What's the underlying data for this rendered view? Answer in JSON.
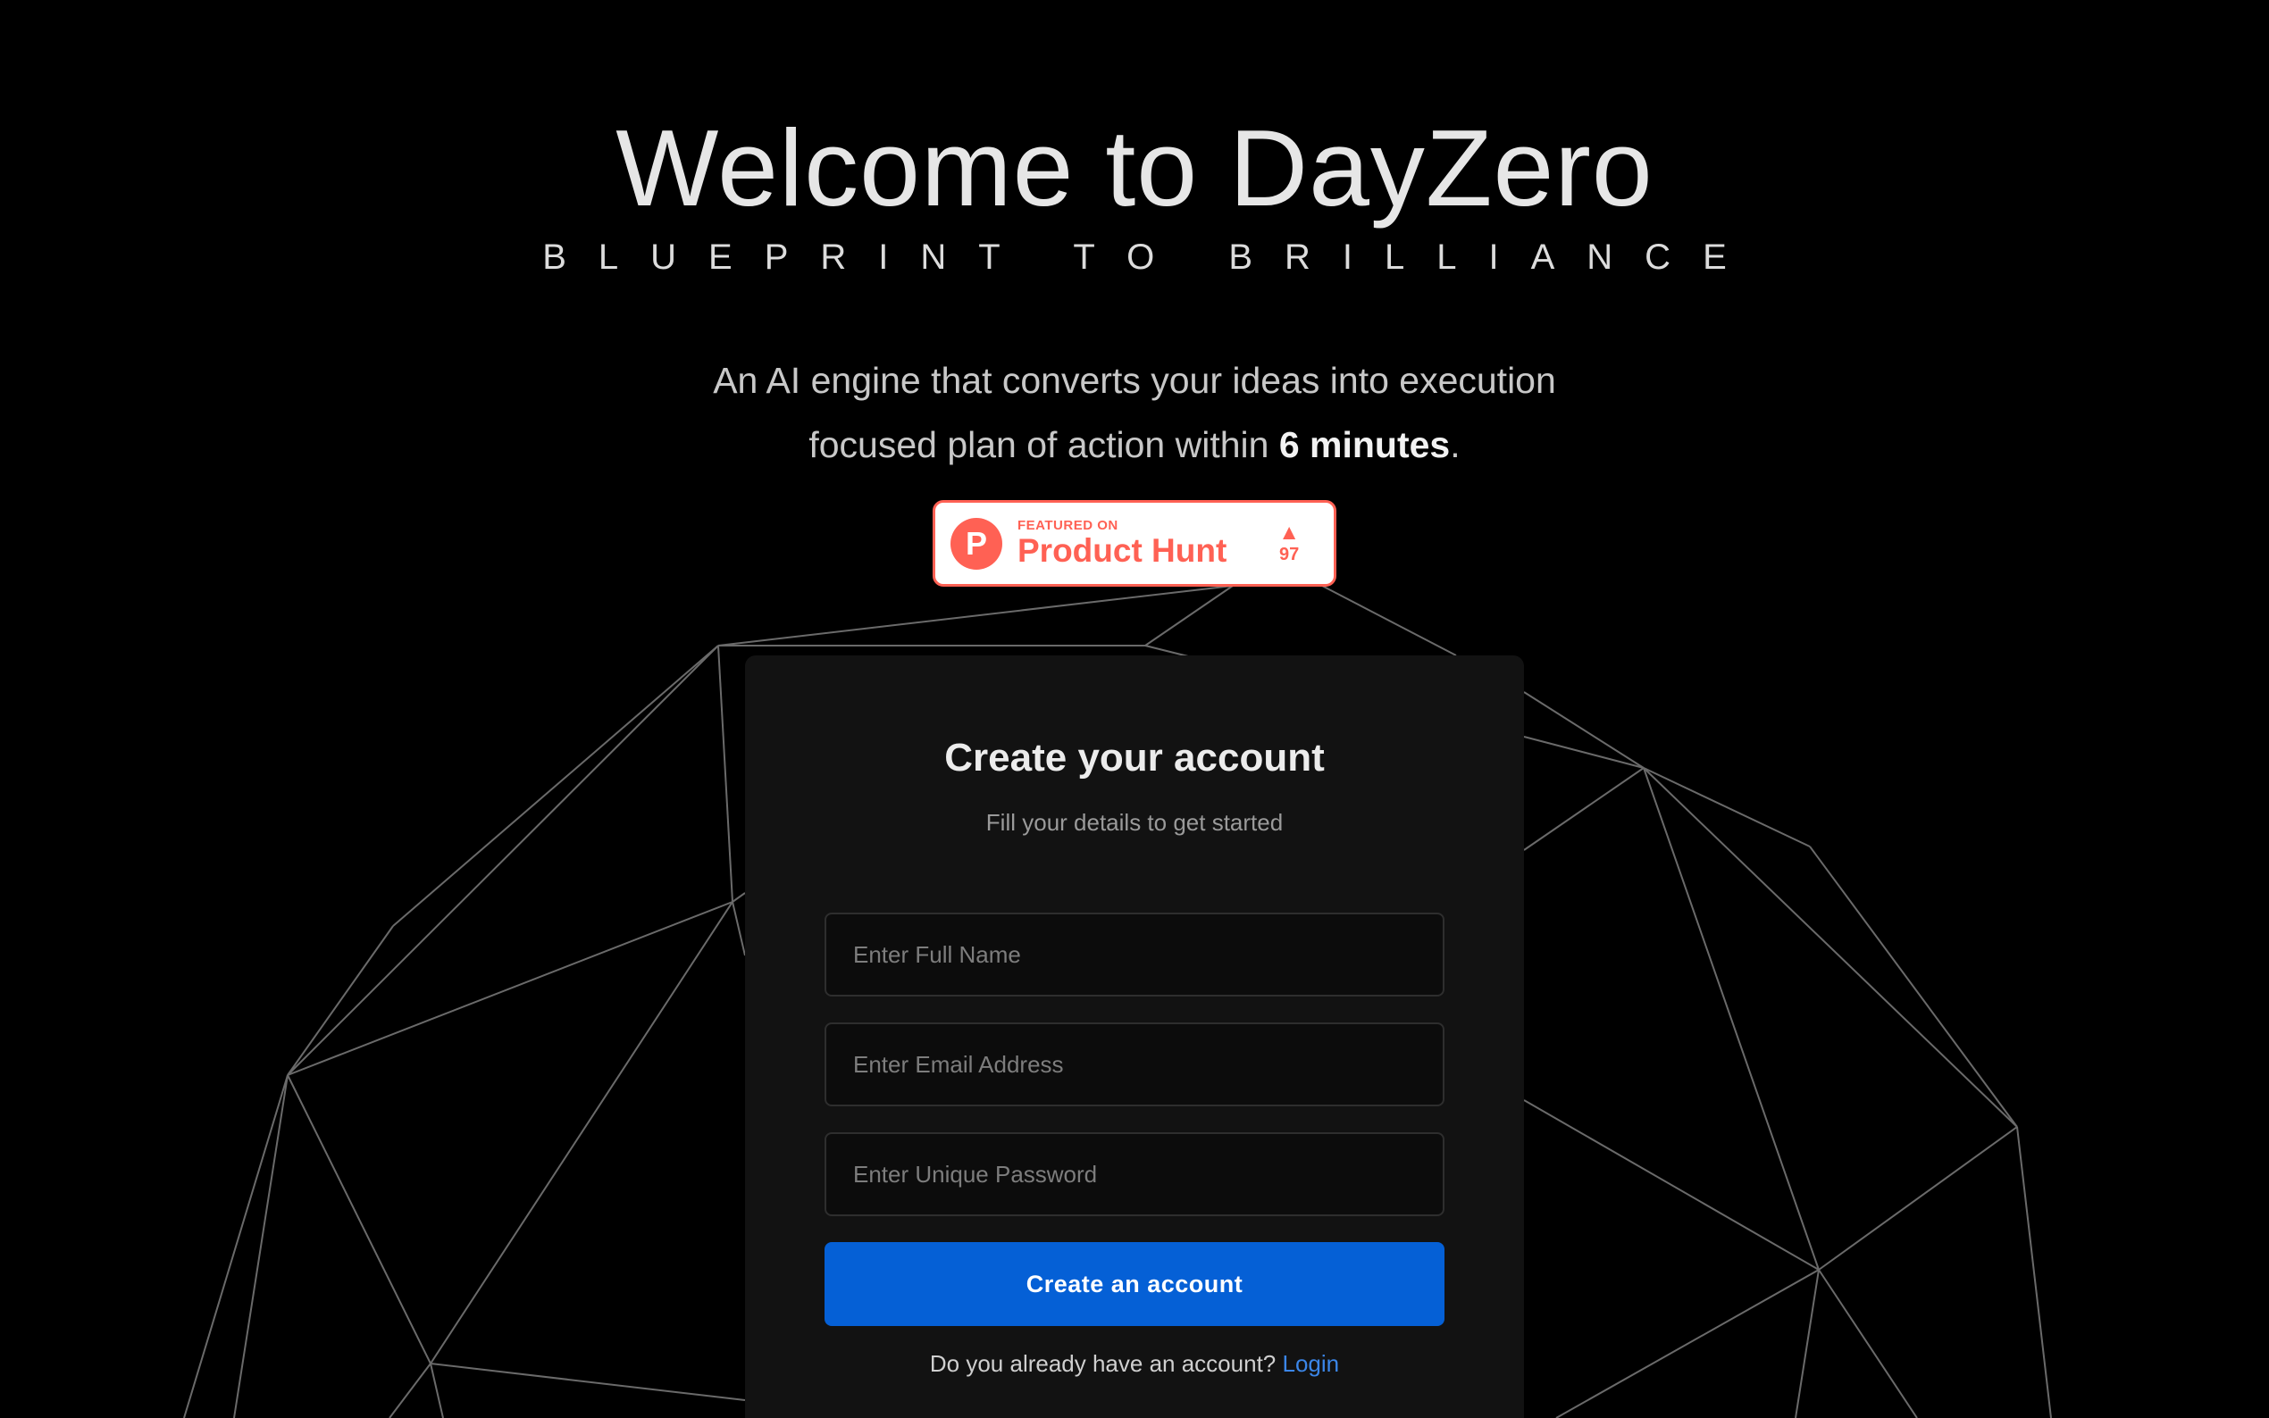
{
  "hero": {
    "title": "Welcome to DayZero",
    "tagline": "BLUEPRINT TO BRILLIANCE",
    "description_line1": "An AI engine that converts your ideas into execution",
    "description_line2_prefix": "focused plan of action within ",
    "description_highlight": "6 minutes",
    "description_suffix": "."
  },
  "product_hunt_badge": {
    "logo_letter": "P",
    "featured_label": "FEATURED ON",
    "name": "Product Hunt",
    "arrow": "▲",
    "votes": "97",
    "color": "#ff6154"
  },
  "signup_card": {
    "title": "Create your account",
    "subtitle": "Fill your details to get started",
    "full_name_placeholder": "Enter Full Name",
    "email_placeholder": "Enter Email Address",
    "password_placeholder": "Enter Unique Password",
    "submit_label": "Create an account",
    "login_prompt": "Do you already have an account?",
    "login_link": "Login"
  },
  "colors": {
    "background": "#000000",
    "card": "#121212",
    "primary_button": "#0560d6",
    "link": "#3b86e8"
  }
}
